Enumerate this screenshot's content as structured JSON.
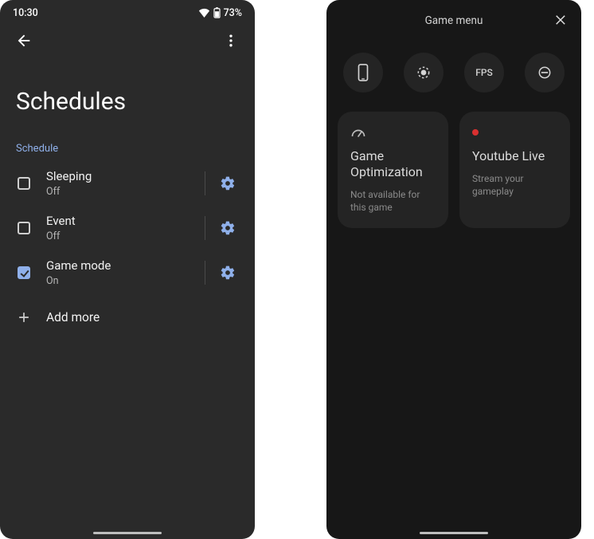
{
  "screen1": {
    "status": {
      "time": "10:30",
      "battery": "73%"
    },
    "title": "Schedules",
    "section_label": "Schedule",
    "items": [
      {
        "name": "Sleeping",
        "state": "Off",
        "checked": false
      },
      {
        "name": "Event",
        "state": "Off",
        "checked": false
      },
      {
        "name": "Game mode",
        "state": "On",
        "checked": true
      }
    ],
    "add_more": "Add more"
  },
  "screen2": {
    "header": "Game menu",
    "circle_fps_label": "FPS",
    "cards": [
      {
        "title": "Game Optimization",
        "sub": "Not available for this game",
        "icon": "gauge"
      },
      {
        "title": "Youtube Live",
        "sub": "Stream your gameplay",
        "icon": "red-dot"
      }
    ]
  },
  "colors": {
    "accent": "#8fb0ea"
  }
}
